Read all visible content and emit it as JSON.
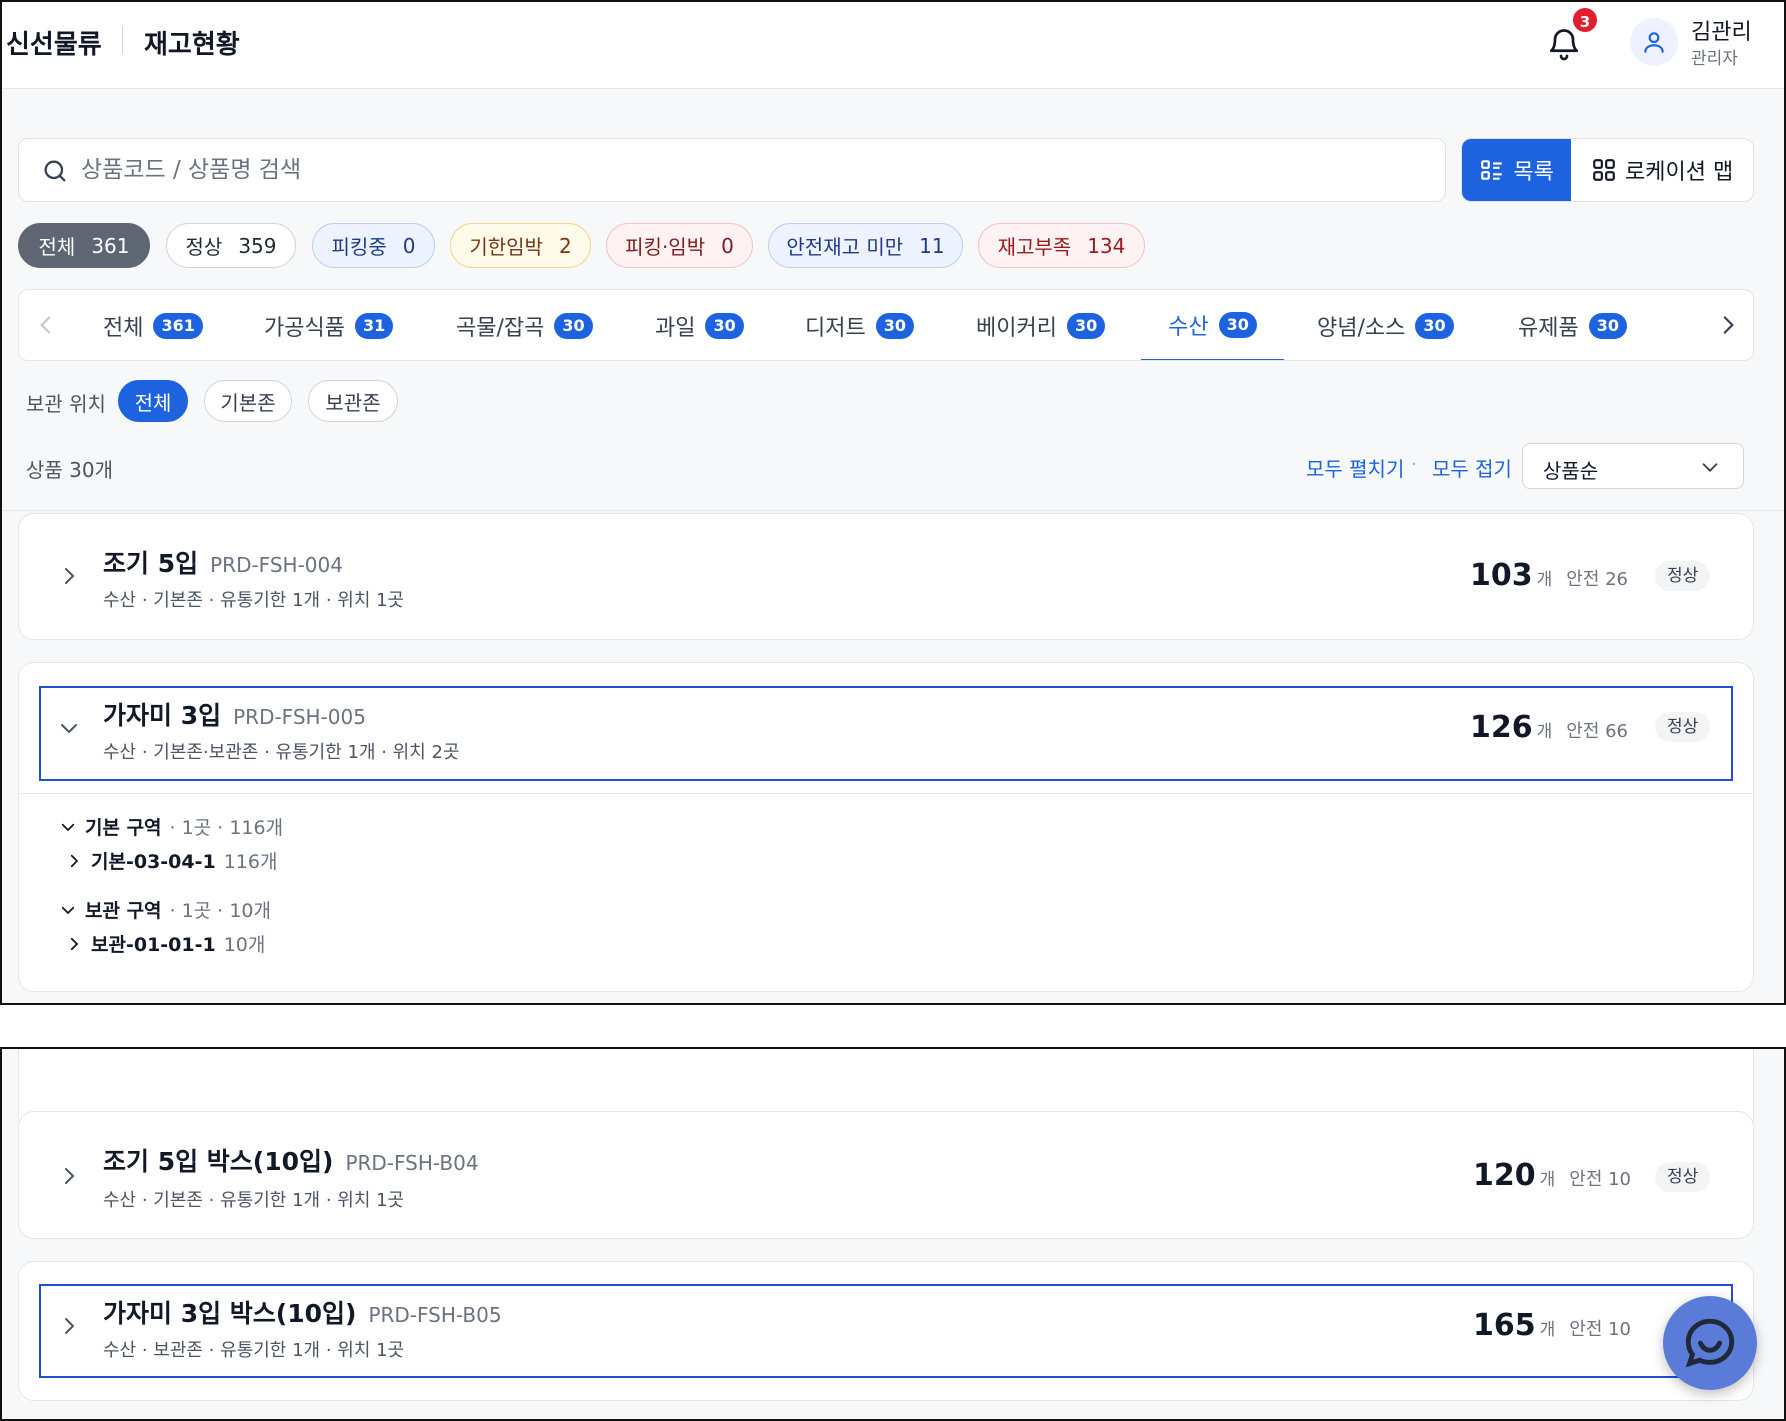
{
  "header": {
    "brand": "신선물류",
    "page_title": "재고현황",
    "notification_count": "3",
    "user_name": "김관리",
    "user_role": "관리자"
  },
  "search": {
    "placeholder": "상품코드 / 상품명 검색",
    "value": ""
  },
  "view_toggle": {
    "list_label": "목록",
    "map_label": "로케이션 맵",
    "selected": "list"
  },
  "status_chips": [
    {
      "label": "전체",
      "count": "361"
    },
    {
      "label": "정상",
      "count": "359"
    },
    {
      "label": "피킹중",
      "count": "0"
    },
    {
      "label": "기한임박",
      "count": "2"
    },
    {
      "label": "피킹·임박",
      "count": "0"
    },
    {
      "label": "안전재고 미만",
      "count": "11"
    },
    {
      "label": "재고부족",
      "count": "134"
    }
  ],
  "categories": [
    {
      "label": "전체",
      "count": "361"
    },
    {
      "label": "가공식품",
      "count": "31"
    },
    {
      "label": "곡물/잡곡",
      "count": "30"
    },
    {
      "label": "과일",
      "count": "30"
    },
    {
      "label": "디저트",
      "count": "30"
    },
    {
      "label": "베이커리",
      "count": "30"
    },
    {
      "label": "수산",
      "count": "30"
    },
    {
      "label": "양념/소스",
      "count": "30"
    },
    {
      "label": "유제품",
      "count": "30"
    }
  ],
  "active_category": "수산",
  "location_filter": {
    "label": "보관 위치",
    "options": [
      "전체",
      "기본존",
      "보관존"
    ],
    "selected": "전체"
  },
  "list": {
    "count_text": "상품 30개",
    "expand_all": "모두 펼치기",
    "collapse_all": "모두 접기",
    "separator": "·",
    "sort_value": "상품순"
  },
  "products": [
    {
      "name": "조기 5입",
      "code": "PRD-FSH-004",
      "meta": "수산 · 기본존 · 유통기한 1개 · 위치 1곳",
      "qty": "103",
      "unit": "개",
      "safety": "안전 26",
      "status": "정상"
    },
    {
      "name": "가자미 3입",
      "code": "PRD-FSH-005",
      "meta": "수산 · 기본존·보관존 · 유통기한 1개 · 위치 2곳",
      "qty": "126",
      "unit": "개",
      "safety": "안전 66",
      "status": "정상",
      "zones": [
        {
          "zone": "기본 구역",
          "summary": "· 1곳 · 116개",
          "location": "기본-03-04-1",
          "loc_qty": "116개"
        },
        {
          "zone": "보관 구역",
          "summary": "· 1곳 · 10개",
          "location": "보관-01-01-1",
          "loc_qty": "10개"
        }
      ]
    },
    {
      "name": "조기 5입 박스(10입)",
      "code": "PRD-FSH-B04",
      "meta": "수산 · 기본존 · 유통기한 1개 · 위치 1곳",
      "qty": "120",
      "unit": "개",
      "safety": "안전 10",
      "status": "정상"
    },
    {
      "name": "가자미 3입 박스(10입)",
      "code": "PRD-FSH-B05",
      "meta": "수산 · 보관존 · 유통기한 1개 · 위치 1곳",
      "qty": "165",
      "unit": "개",
      "safety": "안전 10",
      "status": ""
    }
  ],
  "icons": {
    "bell": "bell-icon",
    "user": "user-icon",
    "search": "search-icon",
    "list": "list-icon",
    "grid": "grid-icon",
    "chat": "chat-icon"
  },
  "colors": {
    "accent": "#1d63e0",
    "selected_border": "#1d4fd8",
    "badge": "#e11d2e"
  }
}
